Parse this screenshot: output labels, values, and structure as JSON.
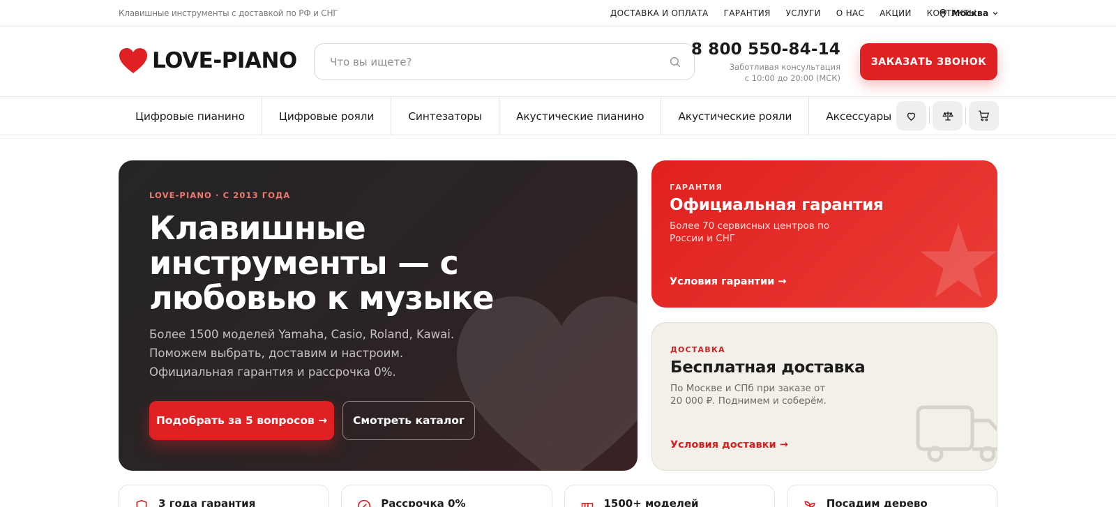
{
  "topbar": {
    "tagline": "Клавишные инструменты с доставкой по РФ и СНГ",
    "nav": [
      "ДОСТАВКА И ОПЛАТА",
      "ГАРАНТИЯ",
      "УСЛУГИ",
      "О НАС",
      "АКЦИИ",
      "КОНТАКТЫ"
    ],
    "city": "Москва"
  },
  "header": {
    "logo_text": "LOVE-PIANO",
    "search_placeholder": "Что вы ищете?",
    "search_value": "",
    "phone": "8 800 550-84-14",
    "phone_note_line1": "Заботливая консультация",
    "phone_note_line2": "с 10:00 до 20:00 (МСК)",
    "call_button": "ЗАКАЗАТЬ ЗВОНОК"
  },
  "categories": [
    "Цифровые пианино",
    "Цифровые рояли",
    "Синтезаторы",
    "Акустические пианино",
    "Акустические рояли",
    "Аксессуары"
  ],
  "header_icons": [
    "heart-icon",
    "scales-icon",
    "cart-icon"
  ],
  "hero": {
    "kicker": "LOVE-PIANO · С 2013 ГОДА",
    "title": "Клавишные инструменты — с любовью к музыке",
    "text": "Более 1500 моделей Yamaha, Casio, Roland, Kawai. Поможем выбрать, доставим и настроим. Официальная гарантия и рассрочка 0%.",
    "primary_button": "Подобрать за 5 вопросов →",
    "secondary_button": "Смотреть каталог"
  },
  "cards": {
    "warranty": {
      "kicker": "ГАРАНТИЯ",
      "title": "Официальная гарантия",
      "text": "Более 70 сервисных центров по России и СНГ",
      "link": "Условия гарантии →"
    },
    "delivery": {
      "kicker": "ДОСТАВКА",
      "title": "Бесплатная доставка",
      "text": "По Москве и СПб при заказе от 20 000 ₽. Поднимем и соберём.",
      "link": "Условия доставки →"
    }
  },
  "features": [
    {
      "title": "3 года гарантия",
      "icon": "shield-icon"
    },
    {
      "title": "Рассрочка 0%",
      "icon": "percent-icon"
    },
    {
      "title": "1500+ моделей",
      "icon": "piano-icon"
    },
    {
      "title": "Посадим дерево",
      "icon": "sprout-icon"
    }
  ],
  "colors": {
    "brand_red": "#df2123",
    "hero_dark": "#252527",
    "delivery_card_bg": "#f3efe9"
  }
}
